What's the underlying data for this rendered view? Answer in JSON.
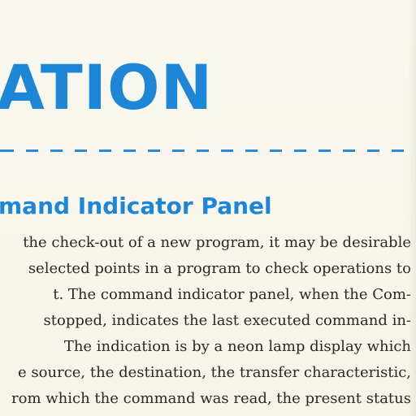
{
  "document": {
    "title_fragment": "ATION",
    "section_heading": "mand Indicator Panel",
    "body_lines": [
      "the check-out of a new program, it may be desirable",
      "selected points in a program to check operations to",
      "t. The command indicator panel, when the Com-",
      "stopped, indicates the last executed command in-",
      "The indication is by a neon lamp display which",
      "e source, the destination, the transfer characteristic,",
      "rom which the command was read, the present status"
    ]
  },
  "colors": {
    "heading_blue": "#1e86d6",
    "text": "#2a2926",
    "paper": "#f7f5ec"
  }
}
